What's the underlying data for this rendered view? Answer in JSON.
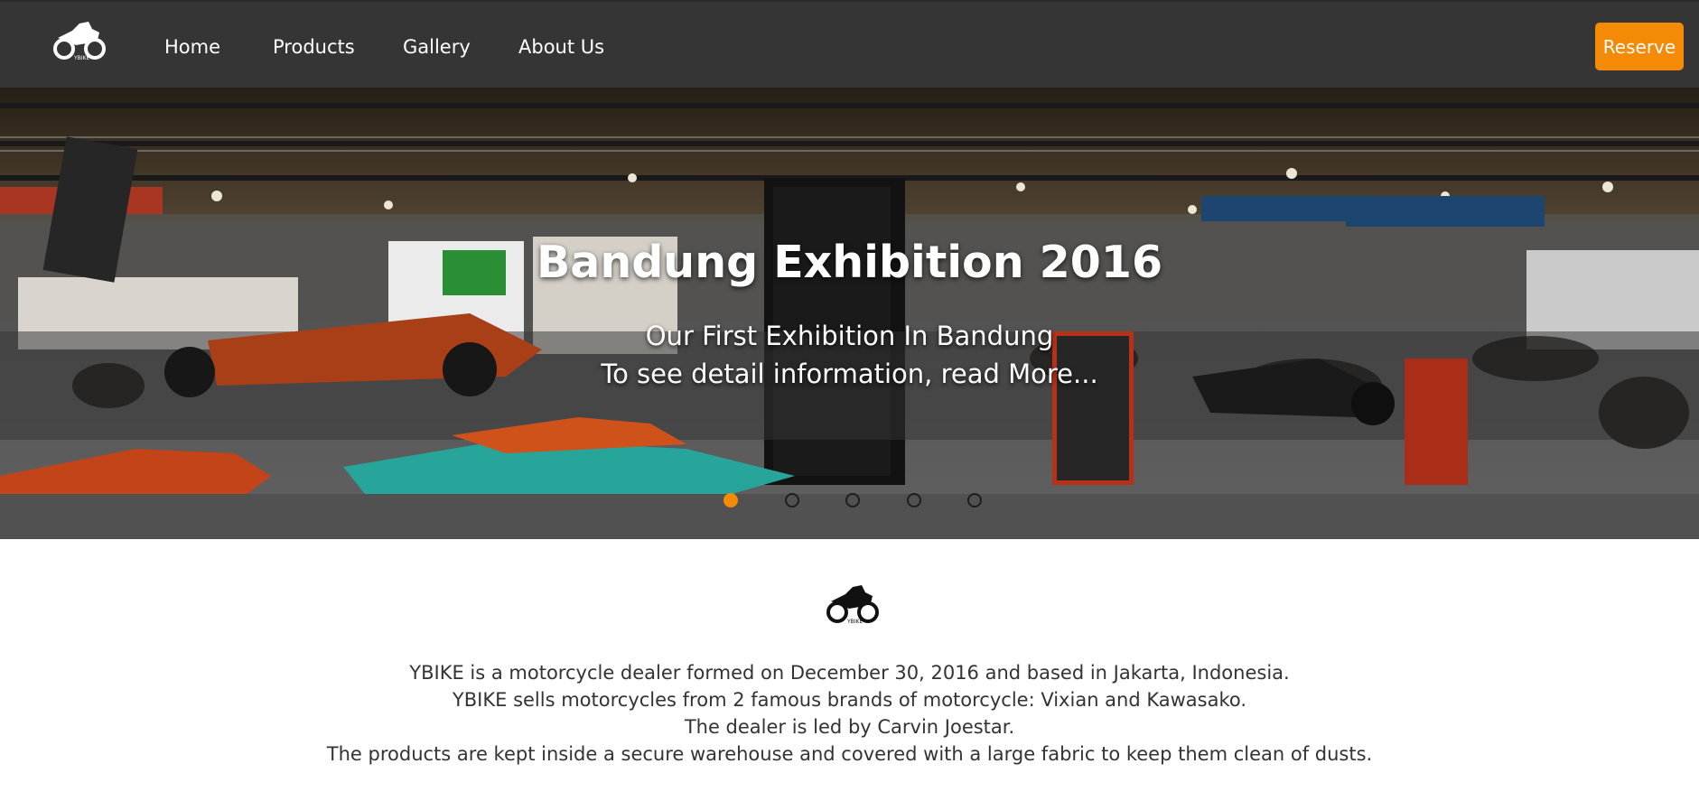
{
  "brand": {
    "name": "YBIKE",
    "logo_icon": "motorcycle-icon"
  },
  "nav": {
    "items": [
      {
        "label": "Home"
      },
      {
        "label": "Products"
      },
      {
        "label": "Gallery"
      },
      {
        "label": "About Us"
      }
    ],
    "reserve_label": "Reserve"
  },
  "colors": {
    "navbar": "#353535",
    "accent": "#f58a07",
    "text": "#333333"
  },
  "carousel": {
    "title": "Bandung Exhibition 2016",
    "subtitle": "Our First Exhibition In Bandung",
    "detail": "To see detail information, read More...",
    "slide_count": 5,
    "active_index": 0
  },
  "about": {
    "lines": [
      "YBIKE is a motorcycle dealer formed on December 30, 2016 and based in Jakarta, Indonesia.",
      "YBIKE sells motorcycles from 2 famous brands of motorcycle: Vixian and Kawasako.",
      "The dealer is led by Carvin Joestar.",
      "The products are kept inside a secure warehouse and covered with a large fabric to keep them clean of dusts."
    ]
  }
}
